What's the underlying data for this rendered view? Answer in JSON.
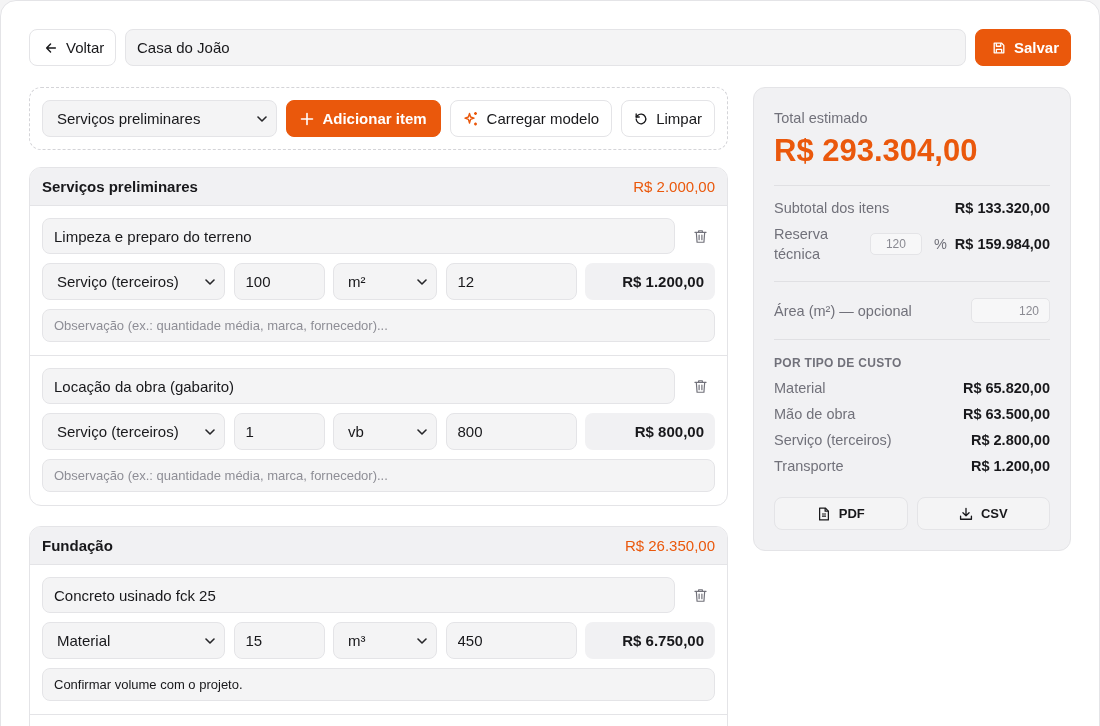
{
  "header": {
    "back_button": {
      "label": "Voltar"
    },
    "project_name": {
      "value": "Casa do João"
    },
    "save_button": {
      "label": "Salvar"
    }
  },
  "toolbar": {
    "stage_select": {
      "value": "Serviços preliminares"
    },
    "buttons": [
      {
        "label": "Adicionar item",
        "kind": "add"
      },
      {
        "label": "Carregar modelo",
        "kind": "template"
      },
      {
        "label": "Limpar",
        "kind": "clear"
      }
    ]
  },
  "sections": [
    {
      "title": "Serviços preliminares",
      "total": "R$ 2.000,00",
      "items": [
        {
          "name": "Limpeza e preparo do terreno",
          "cost_type": "Serviço (terceiros)",
          "quantity": "100",
          "unit": "m²",
          "unit_price": "12",
          "total": "R$ 1.200,00",
          "note": {
            "placeholder": "Observação (ex.: quantidade média, marca, fornecedor)..."
          }
        },
        {
          "name": "Locação da obra (gabarito)",
          "cost_type": "Serviço (terceiros)",
          "quantity": "1",
          "unit": "vb",
          "unit_price": "800",
          "total": "R$ 800,00",
          "note": {
            "placeholder": "Observação (ex.: quantidade média, marca, fornecedor)..."
          }
        }
      ]
    },
    {
      "title": "Fundação",
      "total": "R$ 26.350,00",
      "items": [
        {
          "name": "Concreto usinado fck 25",
          "cost_type": "Material",
          "quantity": "15",
          "unit": "m³",
          "unit_price": "450",
          "total": "R$ 6.750,00",
          "note": {
            "value": "Confirmar volume com o projeto."
          }
        }
      ]
    }
  ],
  "summary": {
    "total_label": "Total estimado",
    "total": "R$ 293.304,00",
    "subtotal": {
      "label": "Subtotal dos itens",
      "value": "R$ 133.320,00"
    },
    "reserve": {
      "label": "Reserva técnica",
      "input": "120",
      "unit": "%",
      "value": "R$ 159.984,00"
    },
    "area": {
      "label": "Área (m²) — opcional",
      "input": "120"
    },
    "breakdown": {
      "title": "POR TIPO DE CUSTO",
      "rows": [
        {
          "label": "Material",
          "value": "R$ 65.820,00"
        },
        {
          "label": "Mão de obra",
          "value": "R$ 63.500,00"
        },
        {
          "label": "Serviço (terceiros)",
          "value": "R$ 2.800,00"
        },
        {
          "label": "Transporte",
          "value": "R$ 1.200,00"
        }
      ]
    },
    "exports": [
      {
        "label": "PDF",
        "kind": "pdf"
      },
      {
        "label": "CSV",
        "kind": "csv"
      }
    ]
  }
}
